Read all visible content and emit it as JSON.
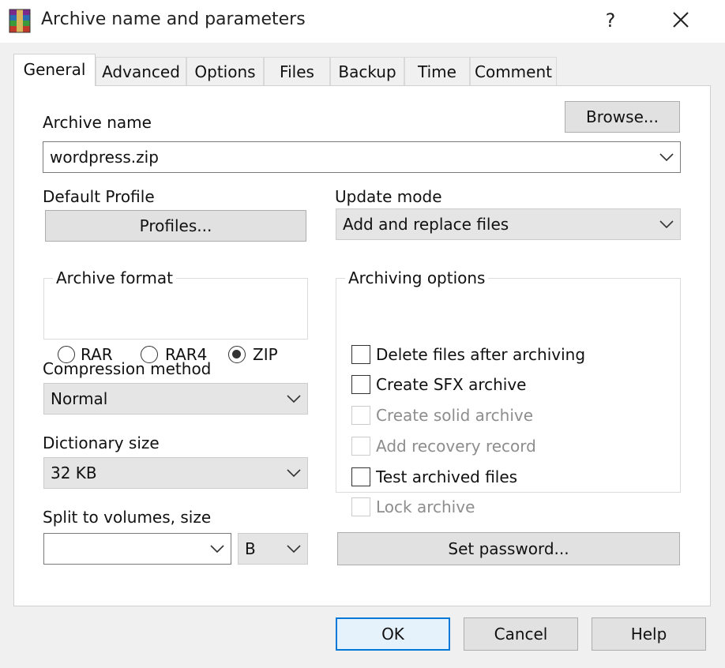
{
  "window": {
    "title": "Archive name and parameters",
    "help_label": "?",
    "close_icon": "close-icon",
    "app_icon": "winrar-books-icon"
  },
  "tabs": [
    {
      "label": "General",
      "active": true
    },
    {
      "label": "Advanced",
      "active": false
    },
    {
      "label": "Options",
      "active": false
    },
    {
      "label": "Files",
      "active": false
    },
    {
      "label": "Backup",
      "active": false
    },
    {
      "label": "Time",
      "active": false
    },
    {
      "label": "Comment",
      "active": false
    }
  ],
  "general": {
    "archive_name_label": "Archive name",
    "browse_label": "Browse...",
    "archive_name_value": "wordpress.zip",
    "default_profile_label": "Default Profile",
    "profiles_label": "Profiles...",
    "update_mode_label": "Update mode",
    "update_mode_value": "Add and replace files",
    "archive_format": {
      "legend": "Archive format",
      "options": [
        "RAR",
        "RAR4",
        "ZIP"
      ],
      "selected": "ZIP"
    },
    "compression_method_label": "Compression method",
    "compression_method_value": "Normal",
    "dictionary_size_label": "Dictionary size",
    "dictionary_size_value": "32 KB",
    "split_label": "Split to volumes, size",
    "split_value": "",
    "split_unit_value": "B",
    "archiving_options": {
      "legend": "Archiving options",
      "items": [
        {
          "label": "Delete files after archiving",
          "checked": false,
          "enabled": true
        },
        {
          "label": "Create SFX archive",
          "checked": false,
          "enabled": true
        },
        {
          "label": "Create solid archive",
          "checked": false,
          "enabled": false
        },
        {
          "label": "Add recovery record",
          "checked": false,
          "enabled": false
        },
        {
          "label": "Test archived files",
          "checked": false,
          "enabled": true
        },
        {
          "label": "Lock archive",
          "checked": false,
          "enabled": false
        }
      ]
    },
    "set_password_label": "Set password..."
  },
  "footer": {
    "ok_label": "OK",
    "cancel_label": "Cancel",
    "help_label": "Help"
  },
  "colors": {
    "client_bg": "#f0f0f0",
    "focus_border": "#0078d7",
    "disabled_text": "#8d8d8d"
  }
}
